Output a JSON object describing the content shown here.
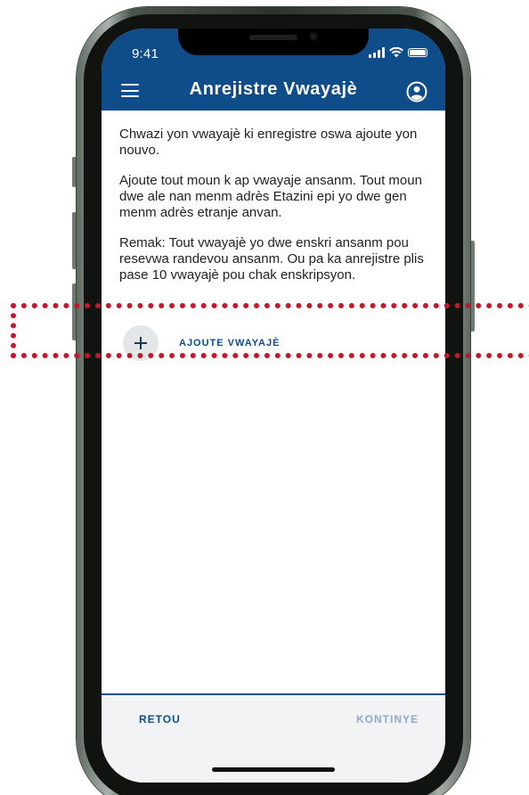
{
  "status_bar": {
    "time": "9:41",
    "signal_icon": "cellular-signal-icon",
    "wifi_icon": "wifi-icon",
    "battery_icon": "battery-icon"
  },
  "header": {
    "title": "Anrejistre Vwayajè",
    "menu_icon": "hamburger-menu-icon",
    "profile_icon": "user-profile-icon",
    "background_color": "#0f4c8a"
  },
  "content": {
    "paragraphs": [
      "Chwazi yon vwayajè ki enregistre oswa ajoute yon nouvo.",
      "Ajoute tout moun k ap vwayaje ansanm. Tout moun dwe ale nan menm adrès Etazini epi yo dwe gen menm adrès etranje anvan.",
      "Remak: Tout vwayajè yo dwe enskri ansanm pou resevwa randevou ansanm. Ou pa ka anrejistre plis pase 10 vwayajè pou chak enskripsyon."
    ]
  },
  "add_traveler": {
    "label": "AJOUTE VWAYAJÈ",
    "icon": "plus-icon"
  },
  "footer": {
    "back_label": "RETOU",
    "next_label": "KONTINYE"
  },
  "colors": {
    "primary": "#0f4c8a",
    "disabled": "#8ea9c9",
    "highlight": "#c4172c"
  }
}
